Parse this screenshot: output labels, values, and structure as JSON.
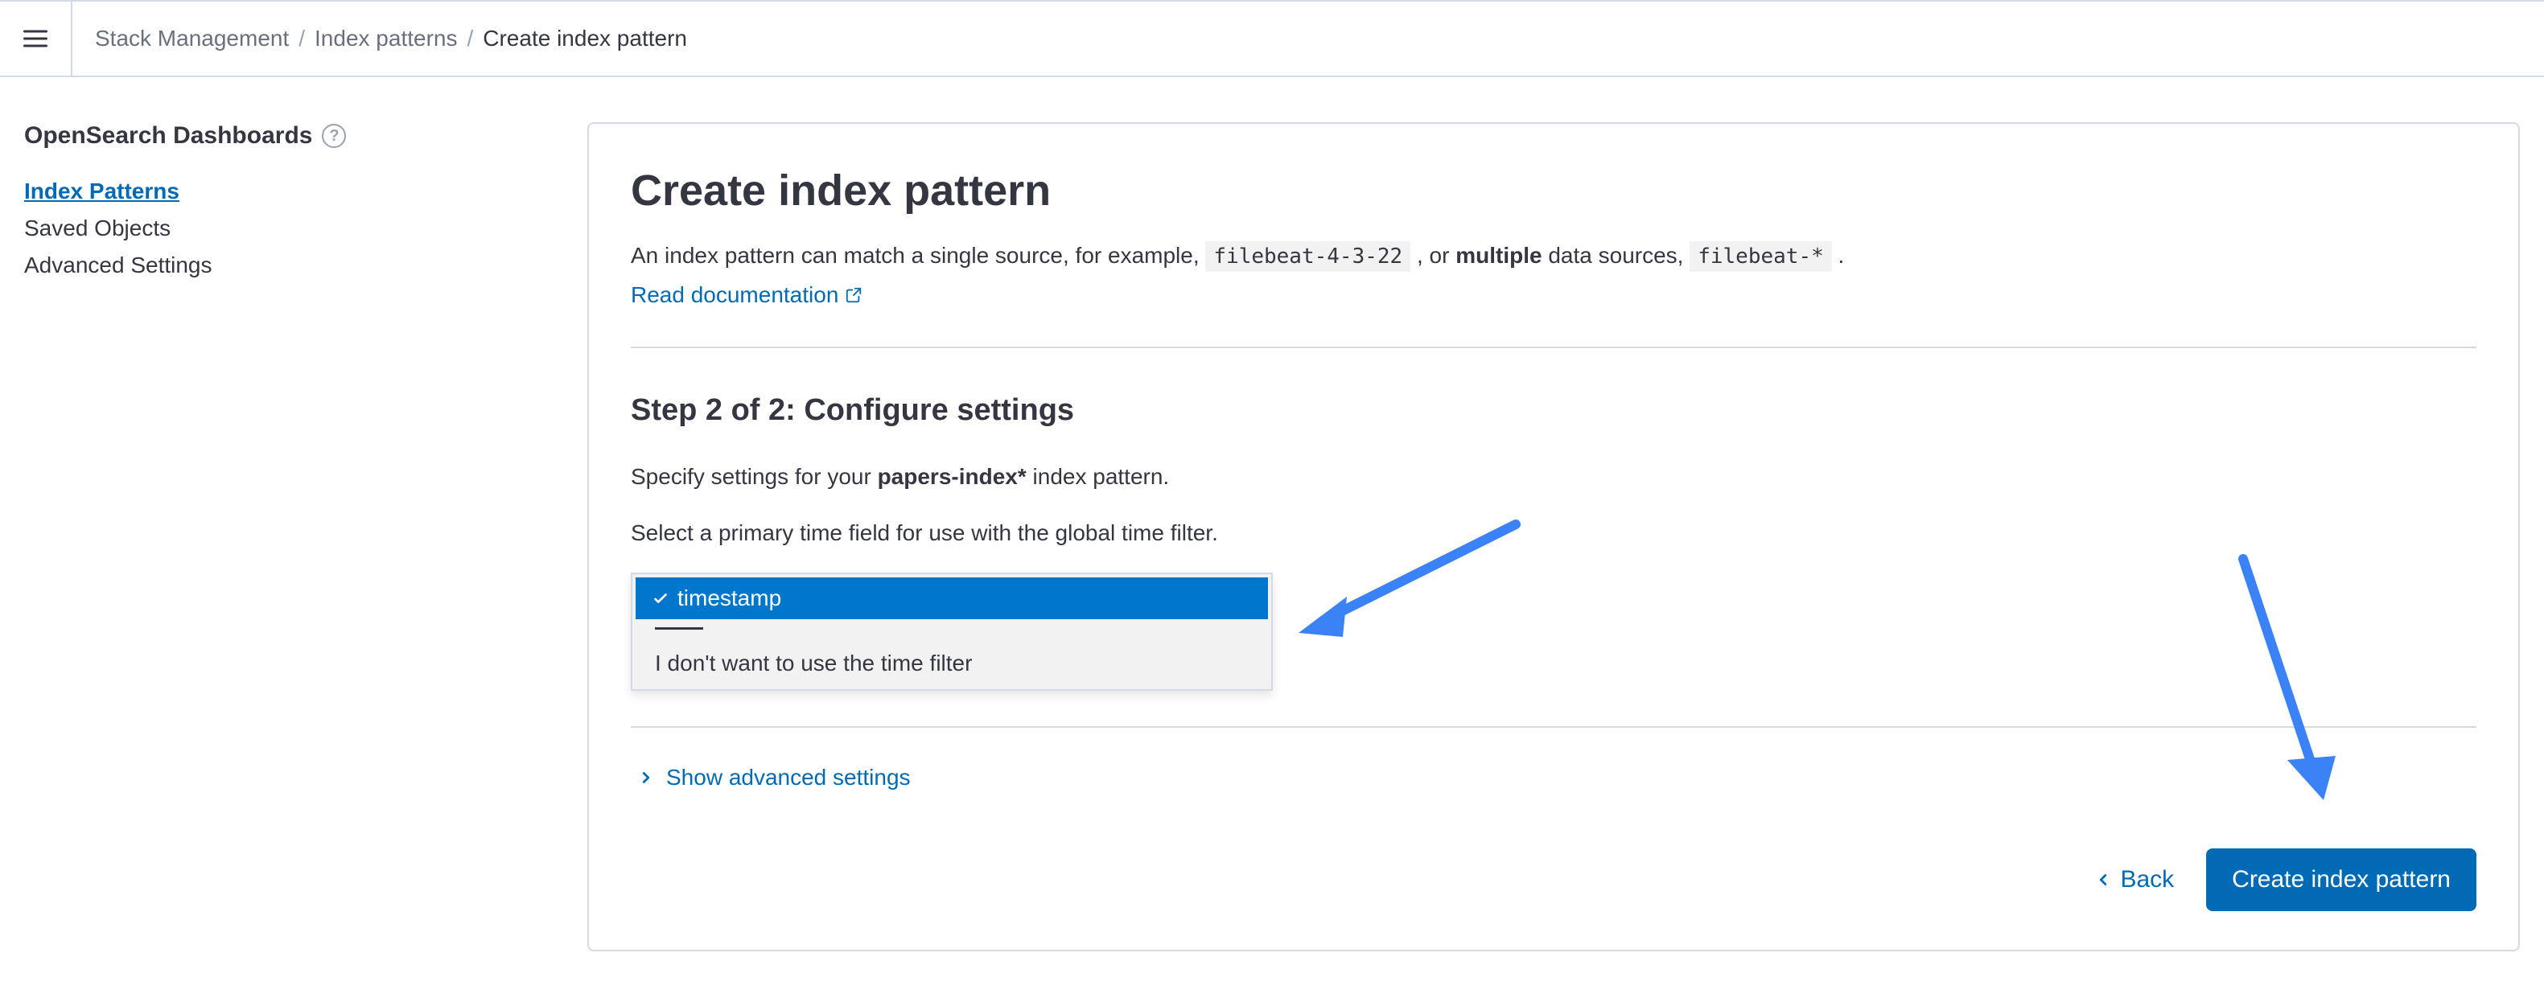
{
  "breadcrumbs": {
    "items": [
      "Stack Management",
      "Index patterns",
      "Create index pattern"
    ]
  },
  "sidebar": {
    "title": "OpenSearch Dashboards",
    "links": {
      "index_patterns": "Index Patterns",
      "saved_objects": "Saved Objects",
      "advanced_settings": "Advanced Settings"
    }
  },
  "panel": {
    "title": "Create index pattern",
    "desc_prefix": "An index pattern can match a single source, for example, ",
    "code1": "filebeat-4-3-22",
    "desc_middle": " , or ",
    "desc_bold": "multiple",
    "desc_suffix": " data sources, ",
    "code2": "filebeat-*",
    "desc_end": " .",
    "doc_link": "Read documentation",
    "step_title": "Step 2 of 2: Configure settings",
    "specify_prefix": "Specify settings for your ",
    "pattern_name": "papers-index*",
    "specify_suffix": " index pattern.",
    "select_time": "Select a primary time field for use with the global time filter.",
    "dropdown": {
      "selected": "timestamp",
      "alt": "I don't want to use the time filter"
    },
    "advanced_toggle": "Show advanced settings",
    "back_button": "Back",
    "create_button": "Create index pattern"
  }
}
